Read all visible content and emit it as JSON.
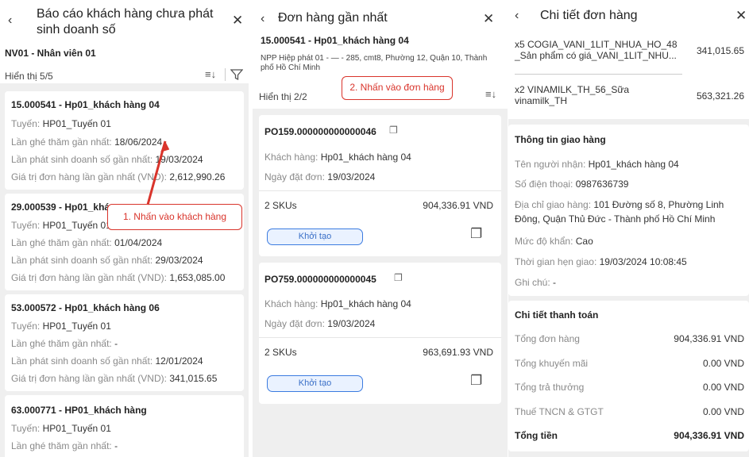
{
  "panel1": {
    "title_line1": "Báo cáo khách hàng chưa phát",
    "title_line2": "sinh doanh số",
    "staff": "NV01 - Nhân viên 01",
    "showing": "Hiển thị 5/5",
    "customers": [
      {
        "name": "15.000541 - Hp01_khách hàng 04",
        "route_label": "Tuyến:",
        "route": "HP01_Tuyến 01",
        "visit_label": "Lần ghé thăm gần nhất:",
        "visit": "18/06/2024",
        "sales_label": "Lần phát sinh doanh số gần nhất:",
        "sales": "19/03/2024",
        "value_label": "Giá trị đơn hàng lần gần nhất (VND):",
        "value": "2,612,990.26"
      },
      {
        "name": "29.000539 - Hp01_khá",
        "route_label": "Tuyến:",
        "route": "HP01_Tuyến 01",
        "visit_label": "Lần ghé thăm gần nhất:",
        "visit": "01/04/2024",
        "sales_label": "Lần phát sinh doanh số gần nhất:",
        "sales": "29/03/2024",
        "value_label": "Giá trị đơn hàng lần gần nhất (VND):",
        "value": "1,653,085.00"
      },
      {
        "name": "53.000572 - Hp01_khách hàng 06",
        "route_label": "Tuyến:",
        "route": "HP01_Tuyến 01",
        "visit_label": "Lần ghé thăm gần nhất:",
        "visit": "-",
        "sales_label": "Lần phát sinh doanh số gần nhất:",
        "sales": "12/01/2024",
        "value_label": "Giá trị đơn hàng lần gần nhất (VND):",
        "value": "341,015.65"
      },
      {
        "name": "63.000771 - HP01_khách hàng",
        "route_label": "Tuyến:",
        "route": "HP01_Tuyến 01",
        "visit_label": "Lần ghé thăm gần nhất:",
        "visit": "-"
      }
    ],
    "callout": "1. Nhấn vào khách hàng"
  },
  "panel2": {
    "title": "Đơn hàng gần nhất",
    "customer": "15.000541 - Hp01_khách hàng 04",
    "address_line1": "NPP Hiệp phát 01 - — - 285, cmt8, Phường 12, Quận 10, Thành",
    "address_line2": "phố Hồ Chí Minh",
    "showing": "Hiển thị 2/2",
    "callout": "2. Nhấn vào đơn hàng",
    "orders": [
      {
        "code": "PO159.000000000000046",
        "customer_label": "Khách hàng:",
        "customer": "Hp01_khách hàng 04",
        "date_label": "Ngày đặt đơn:",
        "date": "19/03/2024",
        "skus": "2 SKUs",
        "amount": "904,336.91 VND",
        "status": "Khởi tạo"
      },
      {
        "code": "PO759.000000000000045",
        "customer_label": "Khách hàng:",
        "customer": "Hp01_khách hàng 04",
        "date_label": "Ngày đặt đơn:",
        "date": "19/03/2024",
        "skus": "2 SKUs",
        "amount": "963,691.93 VND",
        "status": "Khởi tạo"
      }
    ]
  },
  "panel3": {
    "title": "Chi tiết đơn hàng",
    "items": [
      {
        "line1": "x5 COGIA_VANI_1LIT_NHUA_HO_48",
        "line2": "_Sản phẩm có giá_VANI_1LIT_NHU...",
        "price": "341,015.65"
      },
      {
        "line1": "x2 VINAMILK_TH_56_Sữa",
        "line2": "vinamilk_TH",
        "price": "563,321.26"
      }
    ],
    "delivery": {
      "title": "Thông tin giao hàng",
      "receiver_label": "Tên người nhận:",
      "receiver": "Hp01_khách hàng 04",
      "phone_label": "Số điện thoại:",
      "phone": "0987636739",
      "address_label": "Địa chỉ giao hàng:",
      "address_line1": "101 Đường số 8, Phường Linh",
      "address_line2": "Đông, Quận Thủ Đức - Thành phố Hồ Chí Minh",
      "urgency_label": "Mức độ khẩn:",
      "urgency": "Cao",
      "time_label": "Thời gian hẹn giao:",
      "time": "19/03/2024 10:08:45",
      "note_label": "Ghi chú:",
      "note": "-"
    },
    "payment": {
      "title": "Chi tiết thanh toán",
      "rows": [
        {
          "label": "Tổng đơn hàng",
          "value": "904,336.91 VND"
        },
        {
          "label": "Tổng khuyến mãi",
          "value": "0.00 VND"
        },
        {
          "label": "Tổng trả thưởng",
          "value": "0.00 VND"
        },
        {
          "label": "Thuế TNCN & GTGT",
          "value": "0.00 VND"
        }
      ],
      "total_label": "Tổng tiền",
      "total_value": "904,336.91 VND"
    }
  },
  "colors": {
    "accent": "#3b7be0",
    "callout": "#d9342b"
  }
}
